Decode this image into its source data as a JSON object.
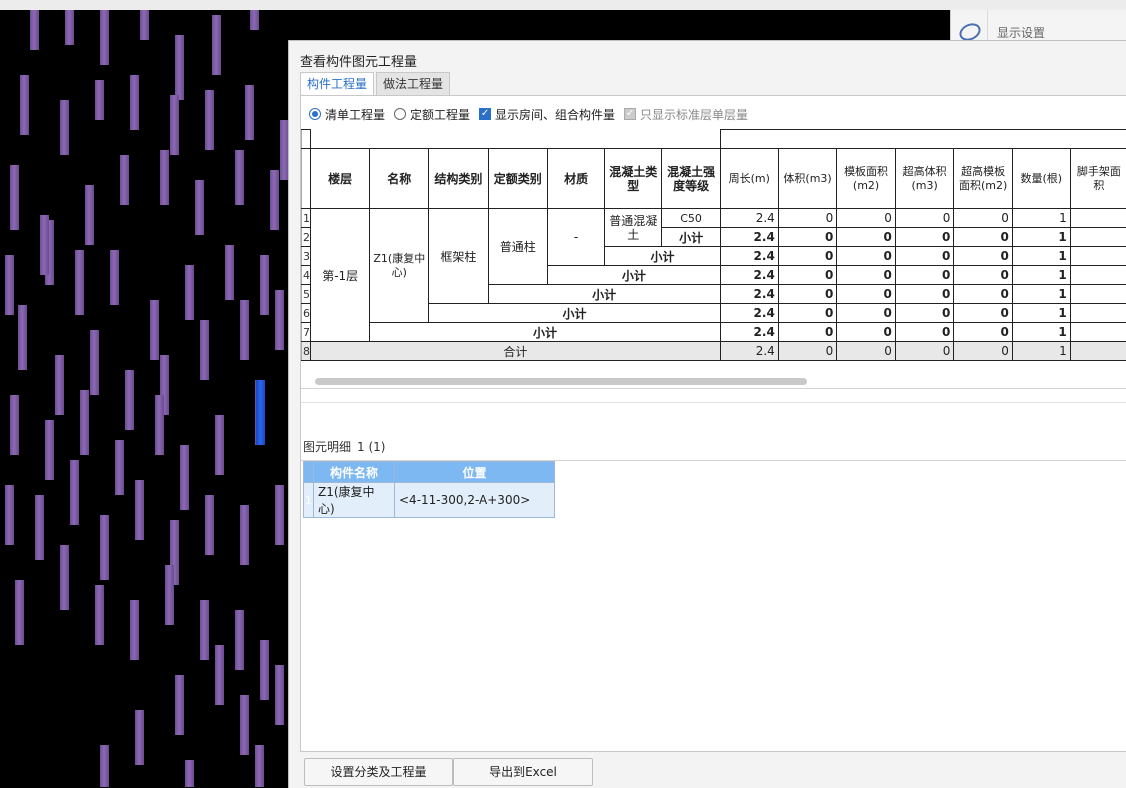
{
  "right_panel": {
    "title": "显示设置"
  },
  "dialog": {
    "title": "查看构件图元工程量",
    "tabs": [
      {
        "label": "构件工程量",
        "active": true
      },
      {
        "label": "做法工程量",
        "active": false
      }
    ],
    "options": {
      "qingdan": {
        "label": "清单工程量",
        "checked": true
      },
      "dinge": {
        "label": "定额工程量",
        "checked": false
      },
      "show_rooms": {
        "label": "显示房间、组合构件量",
        "checked": true
      },
      "std_floor_only": {
        "label": "只显示标准层单层量",
        "checked": true,
        "disabled": true
      }
    },
    "table": {
      "headers": [
        "楼层",
        "名称",
        "结构类别",
        "定额类别",
        "材质",
        "混凝土类型",
        "混凝土强度等级",
        "周长(m)",
        "体积(m3)",
        "模板面积(m2)",
        "超高体积(m3)",
        "超高模板面积(m2)",
        "数量(根)",
        "脚手架面积"
      ],
      "row_numbers": [
        "1",
        "2",
        "3",
        "4",
        "5",
        "6",
        "7",
        "8"
      ],
      "floor": "第-1层",
      "name": "Z1(康复中心)",
      "struct_type": "框架柱",
      "quota_type": "普通柱",
      "material": "-",
      "concrete_type": "普通混凝土",
      "strength": "C50",
      "subtotal_label": "小计",
      "total_label": "合计",
      "rows": [
        {
          "perimeter": "2.4",
          "volume": "0",
          "formwork": "0",
          "high_volume": "0",
          "high_formwork": "0",
          "count": "1"
        },
        {
          "perimeter": "2.4",
          "volume": "0",
          "formwork": "0",
          "high_volume": "0",
          "high_formwork": "0",
          "count": "1"
        },
        {
          "perimeter": "2.4",
          "volume": "0",
          "formwork": "0",
          "high_volume": "0",
          "high_formwork": "0",
          "count": "1"
        },
        {
          "perimeter": "2.4",
          "volume": "0",
          "formwork": "0",
          "high_volume": "0",
          "high_formwork": "0",
          "count": "1"
        },
        {
          "perimeter": "2.4",
          "volume": "0",
          "formwork": "0",
          "high_volume": "0",
          "high_formwork": "0",
          "count": "1"
        },
        {
          "perimeter": "2.4",
          "volume": "0",
          "formwork": "0",
          "high_volume": "0",
          "high_formwork": "0",
          "count": "1"
        },
        {
          "perimeter": "2.4",
          "volume": "0",
          "formwork": "0",
          "high_volume": "0",
          "high_formwork": "0",
          "count": "1"
        },
        {
          "perimeter": "2.4",
          "volume": "0",
          "formwork": "0",
          "high_volume": "0",
          "high_formwork": "0",
          "count": "1"
        }
      ]
    },
    "detail": {
      "label": "图元明细",
      "count": "1 (1)",
      "headers": [
        "构件名称",
        "位置"
      ],
      "rows": [
        {
          "rn": "1",
          "name": "Z1(康复中心)",
          "position": "<4-11-300,2-A+300>"
        }
      ]
    },
    "buttons": {
      "classify": "设置分类及工程量",
      "export": "导出到Excel"
    }
  },
  "colors": {
    "accent": "#2a6fc8",
    "column_purple": "#7d5aa6",
    "column_selected": "#2a66ee",
    "detail_header": "#7db8f2"
  }
}
